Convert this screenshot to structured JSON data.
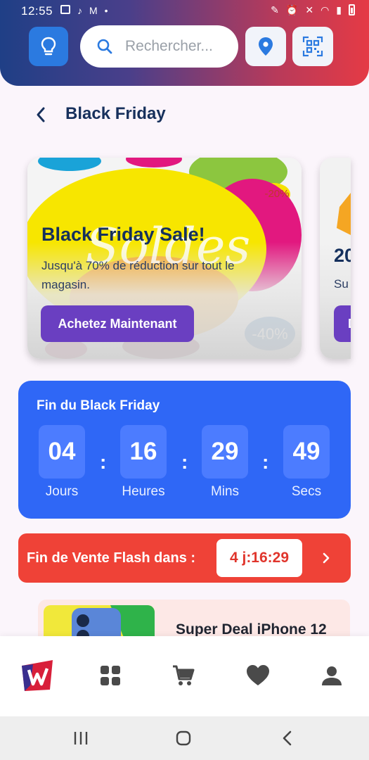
{
  "status_bar": {
    "time": "12:55"
  },
  "header": {
    "search_placeholder": "Rechercher...",
    "icons": {
      "ideas": "lightbulb-icon",
      "search": "search-icon",
      "location": "location-pin-icon",
      "scan": "qr-scan-icon"
    }
  },
  "page": {
    "title": "Black Friday",
    "back_icon": "back-arrow-icon"
  },
  "banners": [
    {
      "title": "Black Friday Sale!",
      "subtitle": "Jusqu'à 70% de réduction sur tout le magasin.",
      "button_label": "Achetez Maintenant"
    },
    {
      "title": "20",
      "subtitle": "Su",
      "button_label": "D"
    }
  ],
  "countdown": {
    "title": "Fin du Black Friday",
    "units": [
      {
        "value": "04",
        "label": "Jours"
      },
      {
        "value": "16",
        "label": "Heures"
      },
      {
        "value": "29",
        "label": "Mins"
      },
      {
        "value": "49",
        "label": "Secs"
      }
    ],
    "separator": ":",
    "color": "#2f67f6"
  },
  "flash_sale": {
    "label": "Fin de Vente Flash dans :",
    "timer": "4 j:16:29",
    "color": "#ef4237"
  },
  "product": {
    "title": "Super Deal iPhone 12"
  },
  "bottom_nav": {
    "items": [
      "logo",
      "categories-icon",
      "cart-icon",
      "heart-icon",
      "profile-icon"
    ]
  },
  "system_nav": {
    "items": [
      "recents-icon",
      "home-icon",
      "back-icon"
    ]
  }
}
